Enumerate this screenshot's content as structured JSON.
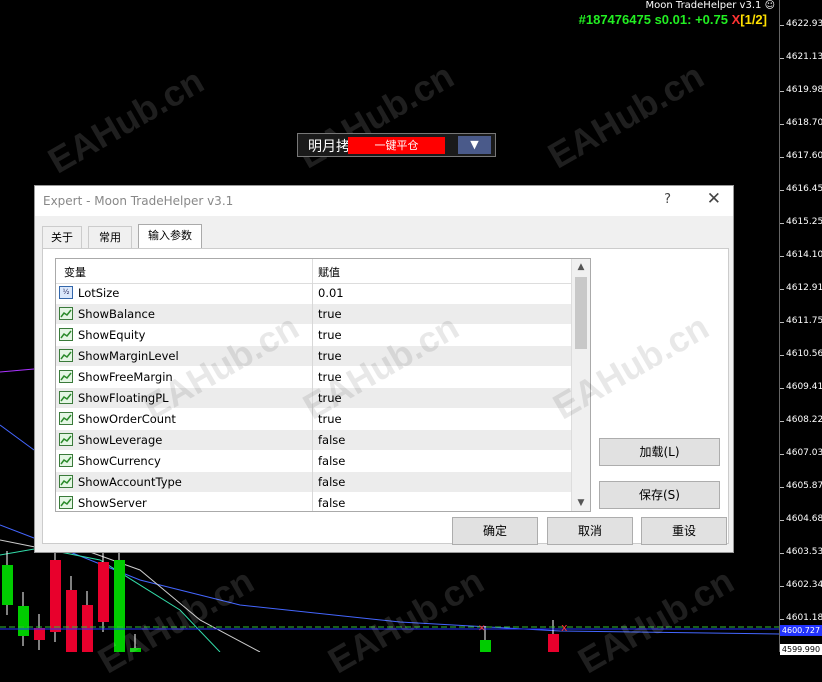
{
  "chart": {
    "ea_title": "Moon TradeHelper v3.1",
    "smiley": "☺",
    "status": {
      "ticket": "#187476475",
      "lot": "s0.01:",
      "profit": "+0.75",
      "close": "X",
      "page": "[1/2]"
    },
    "price_ticks": [
      "4622.935",
      "4621.135",
      "4619.980",
      "4618.705",
      "4617.600",
      "4616.455",
      "4615.255",
      "4614.100",
      "4612.910",
      "4611.755",
      "4610.565",
      "4609.410",
      "4608.220",
      "4607.030",
      "4605.875",
      "4604.685",
      "4603.530",
      "4602.340",
      "4601.185"
    ],
    "current_price": "4600.727",
    "bottom_tick": "4599.990",
    "colors": {
      "bull": "#00cc00",
      "bear": "#e8002c",
      "ma_blue": "#4466ff",
      "ma_purple": "#aa33ff",
      "level": "#2233ff"
    }
  },
  "watermark": "EAHub.cn",
  "toolbar": {
    "name": "明月拷",
    "close_all": "一键平仓",
    "dropdown": "▼"
  },
  "dialog": {
    "title": "Expert - Moon TradeHelper v3.1",
    "help": "?",
    "close": "✕",
    "tabs": [
      "关于",
      "常用",
      "输入参数"
    ],
    "grid": {
      "col_variable": "变量",
      "col_value": "赋值",
      "num_icon": "½",
      "rows": [
        {
          "name": "LotSize",
          "value": "0.01"
        },
        {
          "name": "ShowBalance",
          "value": "true"
        },
        {
          "name": "ShowEquity",
          "value": "true"
        },
        {
          "name": "ShowMarginLevel",
          "value": "true"
        },
        {
          "name": "ShowFreeMargin",
          "value": "true"
        },
        {
          "name": "ShowFloatingPL",
          "value": "true"
        },
        {
          "name": "ShowOrderCount",
          "value": "true"
        },
        {
          "name": "ShowLeverage",
          "value": "false"
        },
        {
          "name": "ShowCurrency",
          "value": "false"
        },
        {
          "name": "ShowAccountType",
          "value": "false"
        },
        {
          "name": "ShowServer",
          "value": "false"
        }
      ]
    },
    "buttons": {
      "load": "加载(L)",
      "save": "保存(S)",
      "ok": "确定",
      "cancel": "取消",
      "reset": "重设"
    }
  }
}
